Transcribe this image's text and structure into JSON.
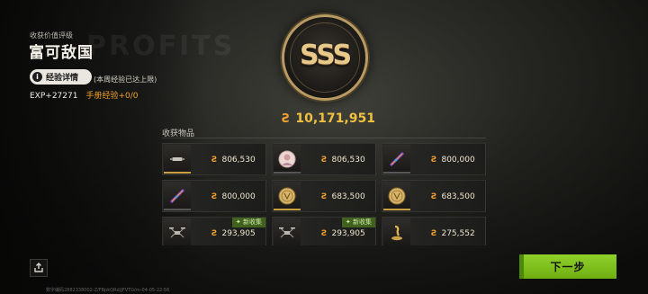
{
  "header": {
    "subtitle": "收获价值评级",
    "title": "富可敌国",
    "watermark": "PROFITS"
  },
  "exp": {
    "detail_label": "经验详情",
    "weekly_cap_note": "(本周经验已达上限)",
    "exp_text": "EXP+27271",
    "book_exp_text": "手册经验+0/0"
  },
  "rank": {
    "grade": "SSS"
  },
  "total": {
    "currency_icon": "coin-icon",
    "value": "10,171,951"
  },
  "loot": {
    "heading": "收获物品",
    "items": [
      {
        "icon": "drone-icon",
        "rarity": "gold",
        "price": "806,530",
        "new_label": ""
      },
      {
        "icon": "portrait-icon",
        "rarity": "plain",
        "price": "806,530",
        "new_label": ""
      },
      {
        "icon": "rifle-icon",
        "rarity": "plain",
        "price": "800,000",
        "new_label": ""
      },
      {
        "icon": "rifle-icon",
        "rarity": "plain",
        "price": "800,000",
        "new_label": ""
      },
      {
        "icon": "gold-coin-icon",
        "rarity": "gold",
        "price": "683,500",
        "new_label": ""
      },
      {
        "icon": "gold-coin-icon",
        "rarity": "gold",
        "price": "683,500",
        "new_label": ""
      },
      {
        "icon": "quad-drone-icon",
        "rarity": "purple",
        "price": "293,905",
        "new_label": "新收集"
      },
      {
        "icon": "quad-drone-icon",
        "rarity": "purple",
        "price": "293,905",
        "new_label": "新收集"
      },
      {
        "icon": "cobra-icon",
        "rarity": "gold",
        "price": "275,552",
        "new_label": ""
      }
    ]
  },
  "footer": {
    "share_icon": "share-icon",
    "next_label": "下一步",
    "code": "数字编码2882338002-Z/FBpkQRd/JFVTLVm-04-05-22:56"
  },
  "colors": {
    "accent_gold": "#f0c040",
    "next_green": "#8fd12a",
    "new_tag_green": "#466e1e"
  }
}
